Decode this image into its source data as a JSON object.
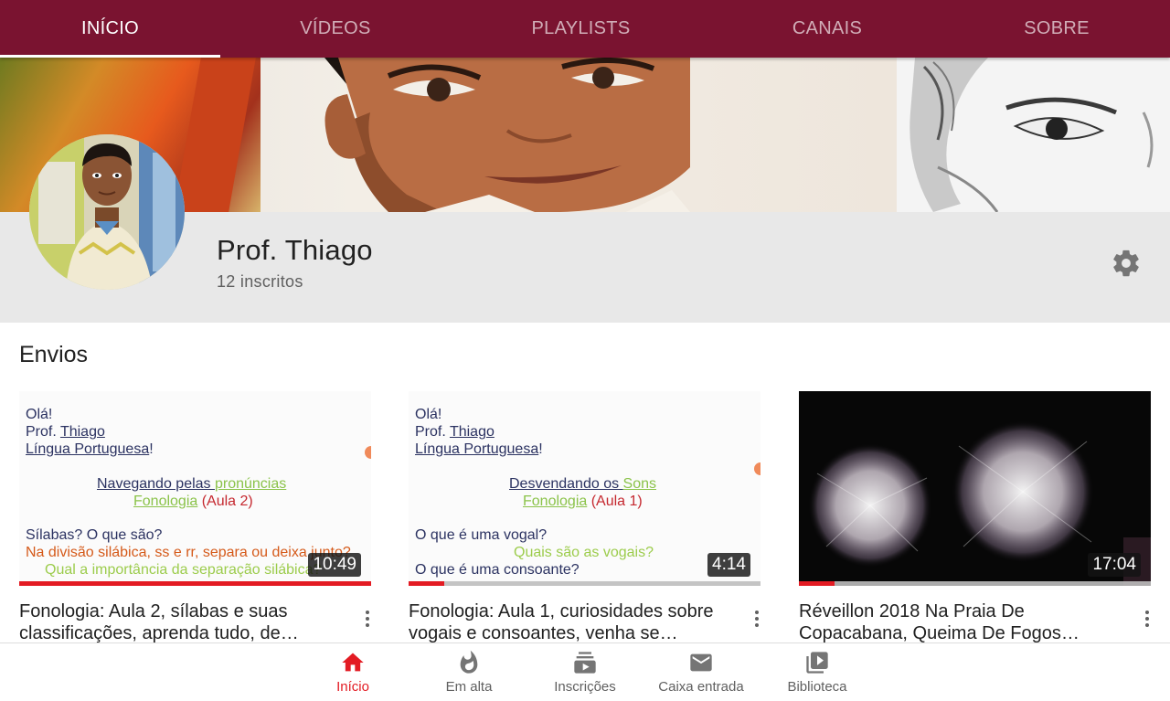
{
  "tabs": [
    {
      "label": "INÍCIO",
      "active": true
    },
    {
      "label": "VÍDEOS"
    },
    {
      "label": "PLAYLISTS"
    },
    {
      "label": "CANAIS"
    },
    {
      "label": "SOBRE"
    }
  ],
  "channel": {
    "name": "Prof. Thiago",
    "subscribers": "12 inscritos"
  },
  "section_title": "Envios",
  "videos": [
    {
      "title": "Fonologia: Aula 2, sílabas e suas classificações, aprenda tudo, de…",
      "duration": "10:49",
      "progress": 1.0,
      "thumb_text": {
        "l1": "Olá!",
        "l2a": "Prof. ",
        "l2b": "Thiago",
        "l3a": "Língua Portuguesa",
        "l3b": "!",
        "l4a": "Navegando pelas ",
        "l4b": "pronúncias",
        "l5a": "Fonologia",
        "l5b": " (Aula 2)",
        "l6": "Sílabas? O que são?",
        "l7": "Na divisão silábica, ss e rr, separa ou deixa junto?",
        "l8": "Qual a importância da separação silábica?"
      }
    },
    {
      "title": "Fonologia: Aula 1, curiosidades sobre vogais e consoantes, venha se…",
      "duration": "4:14",
      "progress": 0.1,
      "thumb_text": {
        "l1": "Olá!",
        "l2a": "Prof. ",
        "l2b": "Thiago",
        "l3a": "Língua Portuguesa",
        "l3b": "!",
        "l4a": "Desvendando os ",
        "l4b": "Sons",
        "l5a": "Fonologia",
        "l5b": " (Aula 1)",
        "l6": "O que é uma vogal?",
        "l7": "Quais são as vogais?",
        "l8": "O que é uma consoante?"
      }
    },
    {
      "title": "Réveillon 2018 Na Praia De Copacabana, Queima De Fogos…",
      "duration": "17:04",
      "progress": 0.1
    }
  ],
  "bottom_nav": [
    {
      "label": "Início",
      "icon": "home-icon",
      "active": true
    },
    {
      "label": "Em alta",
      "icon": "flame-icon"
    },
    {
      "label": "Inscrições",
      "icon": "subscriptions-icon"
    },
    {
      "label": "Caixa entrada",
      "icon": "mail-icon"
    },
    {
      "label": "Biblioteca",
      "icon": "library-icon"
    }
  ],
  "colors": {
    "tab_bar": "#7a1330",
    "accent_red": "#e31b23",
    "header_gray": "#e8e8e8"
  }
}
